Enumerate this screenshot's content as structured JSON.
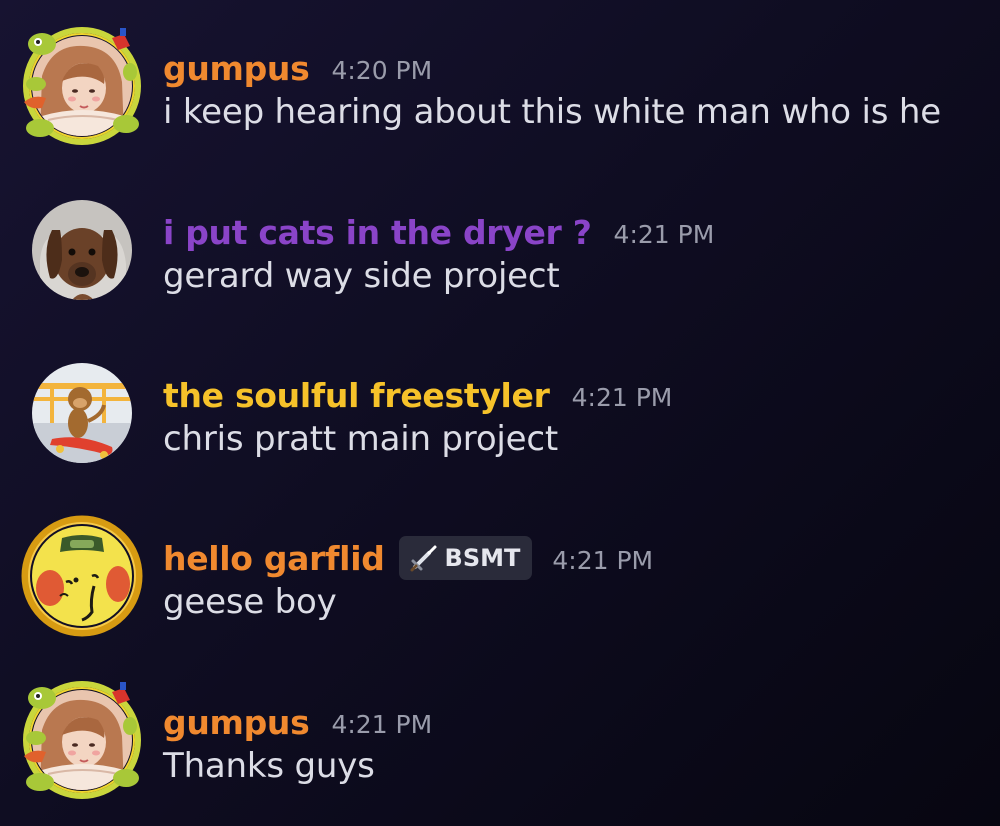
{
  "messages": [
    {
      "username": "gumpus",
      "username_color": "#f0892f",
      "time": "4:20 PM",
      "text": "i keep hearing about this white man who is he",
      "avatar_icon": "frog-decorated-avatar-icon"
    },
    {
      "username": "i put cats in the dryer ?",
      "username_color": "#8a44c8",
      "time": "4:21 PM",
      "text": "gerard way side project",
      "avatar_icon": "dachshund-avatar-icon"
    },
    {
      "username": "the soulful freestyler",
      "username_color": "#f6c22a",
      "time": "4:21 PM",
      "text": "chris pratt main project",
      "avatar_icon": "skateboard-monkey-avatar-icon"
    },
    {
      "username": "hello garflid",
      "username_color": "#f0892f",
      "tag": {
        "label": "BSMT",
        "icon": "sword-icon"
      },
      "time": "4:21 PM",
      "text": "geese boy",
      "avatar_icon": "yellow-face-avatar-icon"
    },
    {
      "username": "gumpus",
      "username_color": "#f0892f",
      "time": "4:21 PM",
      "text": "Thanks guys",
      "avatar_icon": "frog-decorated-avatar-icon"
    }
  ]
}
